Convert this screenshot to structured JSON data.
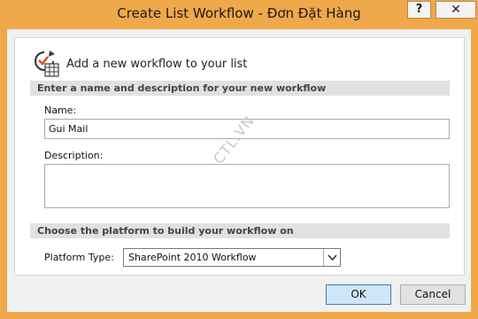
{
  "window": {
    "title": "Create List Workflow - Đơn Đặt Hàng",
    "help_label": "?",
    "close_label": "✕"
  },
  "header": {
    "text": "Add a new workflow to your list",
    "icon": "workflow-icon"
  },
  "sections": {
    "name_description_heading": "Enter a name and description for your new workflow",
    "platform_heading": "Choose the platform to build your workflow on"
  },
  "form": {
    "name_label": "Name:",
    "name_value": "Gui Mail",
    "description_label": "Description:",
    "description_value": "",
    "platform_label": "Platform Type:",
    "platform_value": "SharePoint 2010 Workflow"
  },
  "watermark": "CTL.VN",
  "buttons": {
    "ok": "OK",
    "cancel": "Cancel"
  },
  "colors": {
    "frame": "#efa84a",
    "section_bar": "#e1e1e1",
    "ok_button": "#cfe6f9"
  }
}
